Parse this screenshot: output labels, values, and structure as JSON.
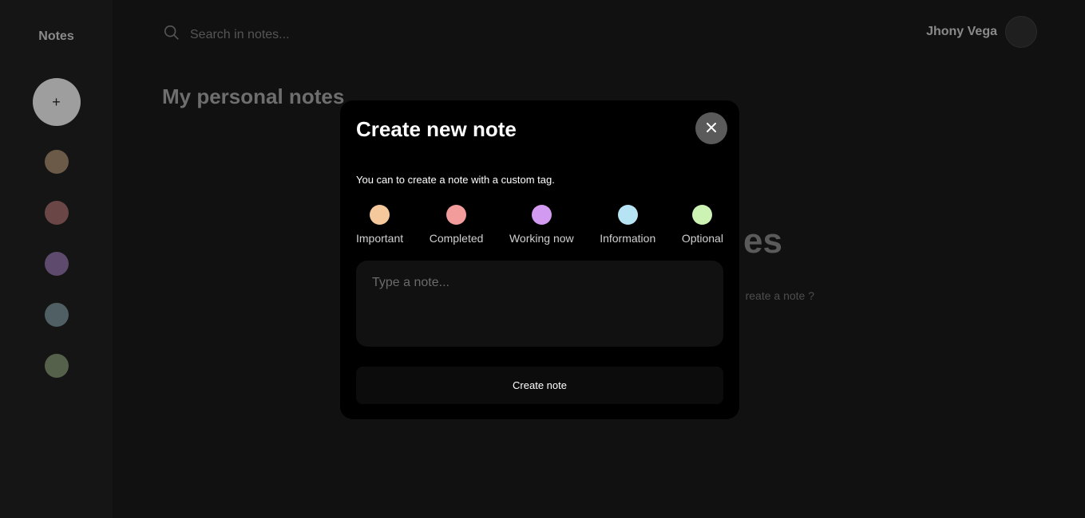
{
  "sidebar": {
    "brand": "Notes",
    "add_label": "+",
    "tags": [
      {
        "name": "important",
        "color": "#6b5a47"
      },
      {
        "name": "completed",
        "color": "#6a4646"
      },
      {
        "name": "working-now",
        "color": "#5e4a6c"
      },
      {
        "name": "information",
        "color": "#4f5f63"
      },
      {
        "name": "optional",
        "color": "#56614c"
      }
    ]
  },
  "header": {
    "search_placeholder": "Search in notes...",
    "search_icon": "search-icon",
    "user_name": "Jhony Vega"
  },
  "main": {
    "title": "My personal notes",
    "empty_title_visible": "es",
    "empty_subtitle_visible": "reate a note ?"
  },
  "modal": {
    "title": "Create new note",
    "close_icon": "close-icon",
    "description": "You can to create a note with a custom tag.",
    "tags": [
      {
        "label": "Important",
        "color": "#f6c99d"
      },
      {
        "label": "Completed",
        "color": "#f39c9c"
      },
      {
        "label": "Working now",
        "color": "#d39af2"
      },
      {
        "label": "Information",
        "color": "#b7e4f4"
      },
      {
        "label": "Optional",
        "color": "#cdf3b4"
      }
    ],
    "note_placeholder": "Type a note...",
    "create_label": "Create note"
  }
}
